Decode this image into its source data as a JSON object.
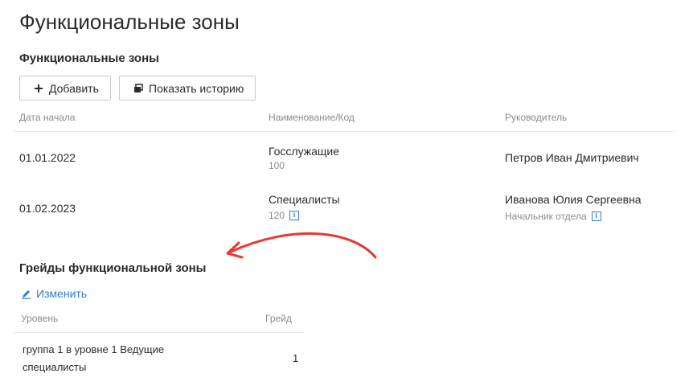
{
  "page": {
    "title": "Функциональные зоны"
  },
  "zones": {
    "section_title": "Функциональные зоны",
    "add_label": "Добавить",
    "history_label": "Показать историю",
    "columns": {
      "date": "Дата начала",
      "name": "Наименование/Код",
      "head": "Руководитель"
    },
    "rows": [
      {
        "date": "01.01.2022",
        "name": "Госслужащие",
        "code": "100",
        "head": "Петров Иван Дмитриевич",
        "head_sub": ""
      },
      {
        "date": "01.02.2023",
        "name": "Специалисты",
        "code": "120",
        "head": "Иванова Юлия Сергеевна",
        "head_sub": "Начальник отдела"
      }
    ]
  },
  "grades": {
    "title": "Грейды функциональной зоны",
    "edit_label": "Изменить",
    "columns": {
      "level": "Уровень",
      "grade": "Грейд"
    },
    "rows": [
      {
        "level": "группа 1 в уровне 1 Ведущие специалисты",
        "grade": "1"
      }
    ]
  },
  "colors": {
    "accent": "#2f7dd1",
    "annotation_arrow": "#e53935",
    "muted": "#8a8a8a",
    "border": "#e6e6e6"
  },
  "icons": {
    "add": "plus-icon",
    "history": "history-icon",
    "info": "info-icon",
    "edit": "pencil-icon"
  }
}
